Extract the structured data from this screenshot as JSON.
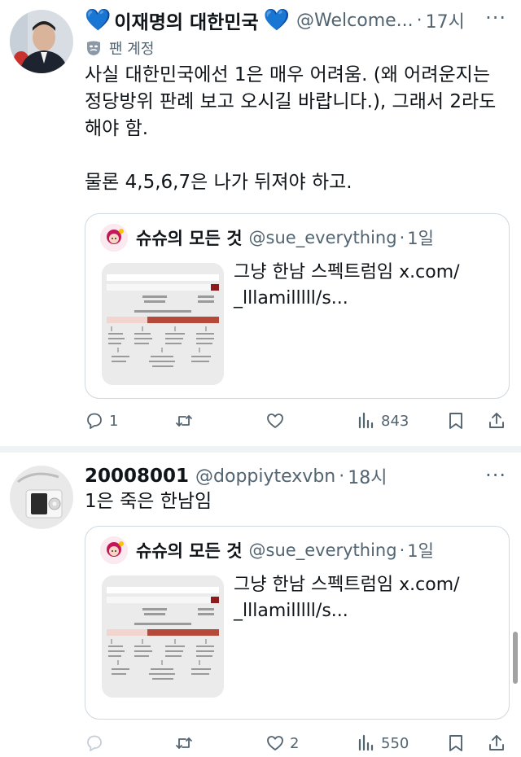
{
  "colors": {
    "accent_blue": "#1d9bf0",
    "heart_blue": "#3d8bf3",
    "secondary_text": "#536471",
    "border": "#cfd9de"
  },
  "tweets": [
    {
      "name": "이재명의 대한민국",
      "name_emoji": "💙",
      "handle": "@Welcome...",
      "sep": "·",
      "time": "17시",
      "more": "···",
      "label": "팬 계정",
      "label_icon": "mask-icon",
      "text": "사실 대한민국에선 1은 매우 어려움. (왜 어려운지는\n정당방위 판례 보고 오시길 바랍니다.), 그래서 2라도\n해야 함.\n\n물론 4,5,6,7은 나가 뒤져야 하고.",
      "quote": {
        "name": "슈슈의 모든 것",
        "handle": "@sue_everything",
        "sep": "·",
        "time": "1일",
        "text": "그냥 한남 스펙트럼임 x.com/\n_lllamilllll/s..."
      },
      "actions": {
        "reply": "1",
        "retweet": "",
        "like": "",
        "views": "843"
      }
    },
    {
      "name": "20008001",
      "handle": "@doppiytexvbn",
      "sep": "·",
      "time": "18시",
      "more": "···",
      "text": "1은 죽은 한남임",
      "quote": {
        "name": "슈슈의 모든 것",
        "handle": "@sue_everything",
        "sep": "·",
        "time": "1일",
        "text": "그냥 한남 스펙트럼임 x.com/\n_lllamilllll/s..."
      },
      "actions": {
        "reply": "",
        "retweet": "",
        "like": "2",
        "views": "550"
      }
    }
  ]
}
